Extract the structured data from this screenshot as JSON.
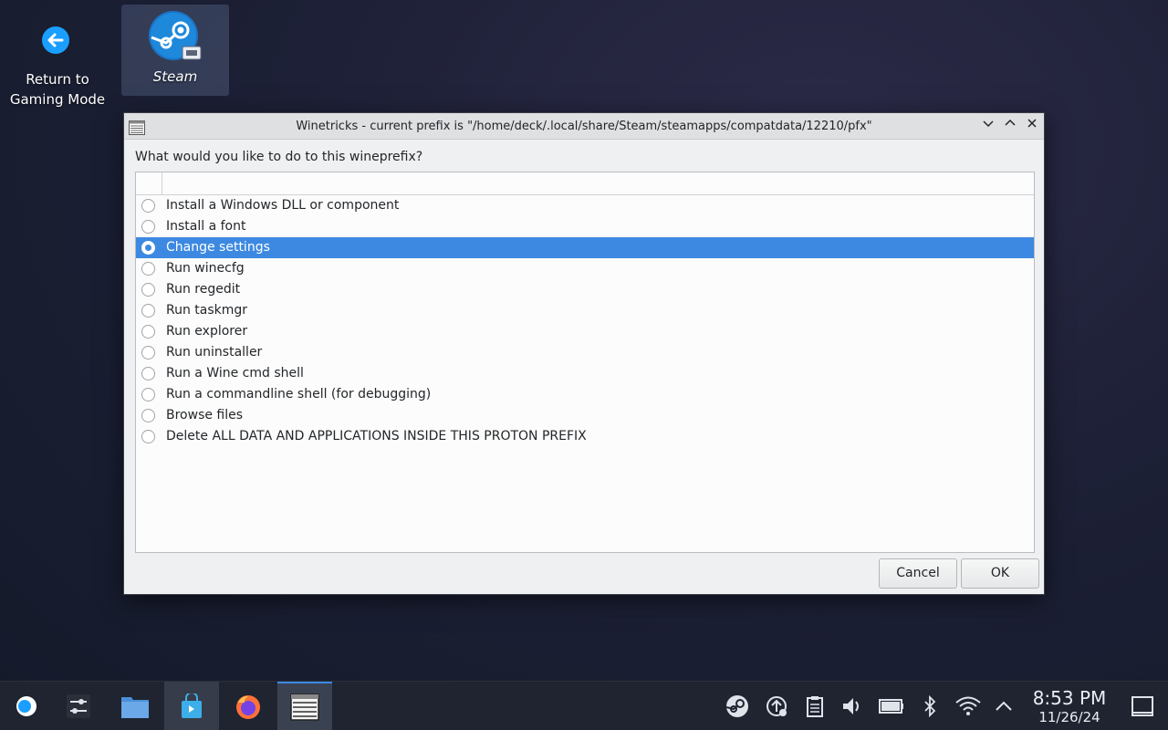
{
  "desktop": {
    "return_label_line1": "Return to",
    "return_label_line2": "Gaming Mode",
    "steam_label": "Steam"
  },
  "window": {
    "title": "Winetricks - current prefix is \"/home/deck/.local/share/Steam/steamapps/compatdata/12210/pfx\"",
    "question": "What would you like to do to this wineprefix?",
    "options": [
      {
        "label": "Install a Windows DLL or component",
        "selected": false
      },
      {
        "label": "Install a font",
        "selected": false
      },
      {
        "label": "Change settings",
        "selected": true
      },
      {
        "label": "Run winecfg",
        "selected": false
      },
      {
        "label": "Run regedit",
        "selected": false
      },
      {
        "label": "Run taskmgr",
        "selected": false
      },
      {
        "label": "Run explorer",
        "selected": false
      },
      {
        "label": "Run uninstaller",
        "selected": false
      },
      {
        "label": "Run a Wine cmd shell",
        "selected": false
      },
      {
        "label": "Run a commandline shell (for debugging)",
        "selected": false
      },
      {
        "label": "Browse files",
        "selected": false
      },
      {
        "label": "Delete ALL DATA AND APPLICATIONS INSIDE THIS PROTON PREFIX",
        "selected": false
      }
    ],
    "cancel_label": "Cancel",
    "ok_label": "OK"
  },
  "taskbar": {
    "apps": [
      "steam-deck-launcher-icon",
      "system-settings-icon",
      "file-manager-icon",
      "discover-store-icon",
      "firefox-icon",
      "winetricks-icon"
    ],
    "tray": [
      "steam-tray-icon",
      "update-icon",
      "clipboard-icon",
      "volume-icon",
      "battery-icon",
      "bluetooth-icon",
      "wifi-icon",
      "tray-expand-icon"
    ],
    "time": "8:53 PM",
    "date": "11/26/24"
  },
  "colors": {
    "accent": "#3d89e2",
    "window_bg": "#eff0f1",
    "taskbar_bg": "#1f2430"
  }
}
